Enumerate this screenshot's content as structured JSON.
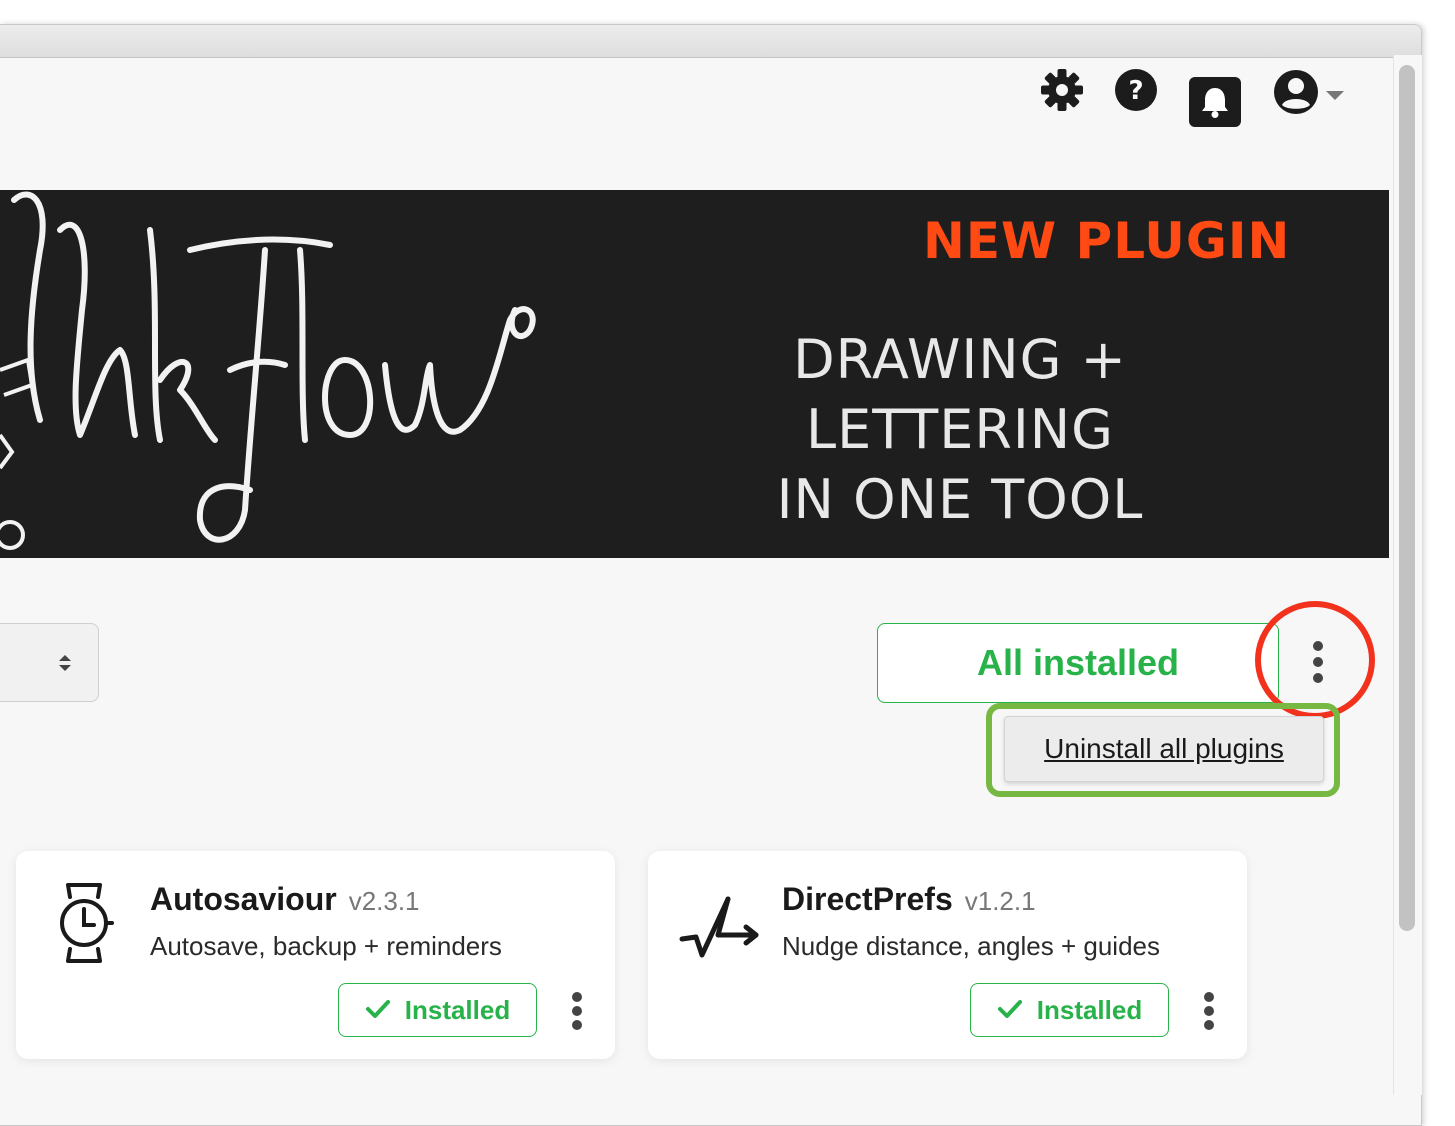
{
  "header": {
    "icons": [
      "gear-icon",
      "help-icon",
      "bell-icon",
      "user-icon"
    ]
  },
  "banner": {
    "logo_text": "InkFlow",
    "badge": "NEW PLUGIN",
    "tagline_line1": "DRAWING + LETTERING",
    "tagline_line2": "IN ONE TOOL",
    "badge_color": "#ff4a14"
  },
  "toolbar": {
    "all_installed_label": "All installed",
    "menu_item_uninstall_all": "Uninstall all plugins"
  },
  "plugins": [
    {
      "name": "Autosaviour",
      "version": "v2.3.1",
      "description": "Autosave, backup + reminders",
      "status": "Installed",
      "icon": "watch-icon"
    },
    {
      "name": "DirectPrefs",
      "version": "v1.2.1",
      "description": "Nudge distance, angles + guides",
      "status": "Installed",
      "icon": "checkmark-arrow-icon"
    }
  ],
  "colors": {
    "accent_green": "#27b24a",
    "highlight_red": "#f2321d",
    "highlight_green": "#77b843"
  }
}
